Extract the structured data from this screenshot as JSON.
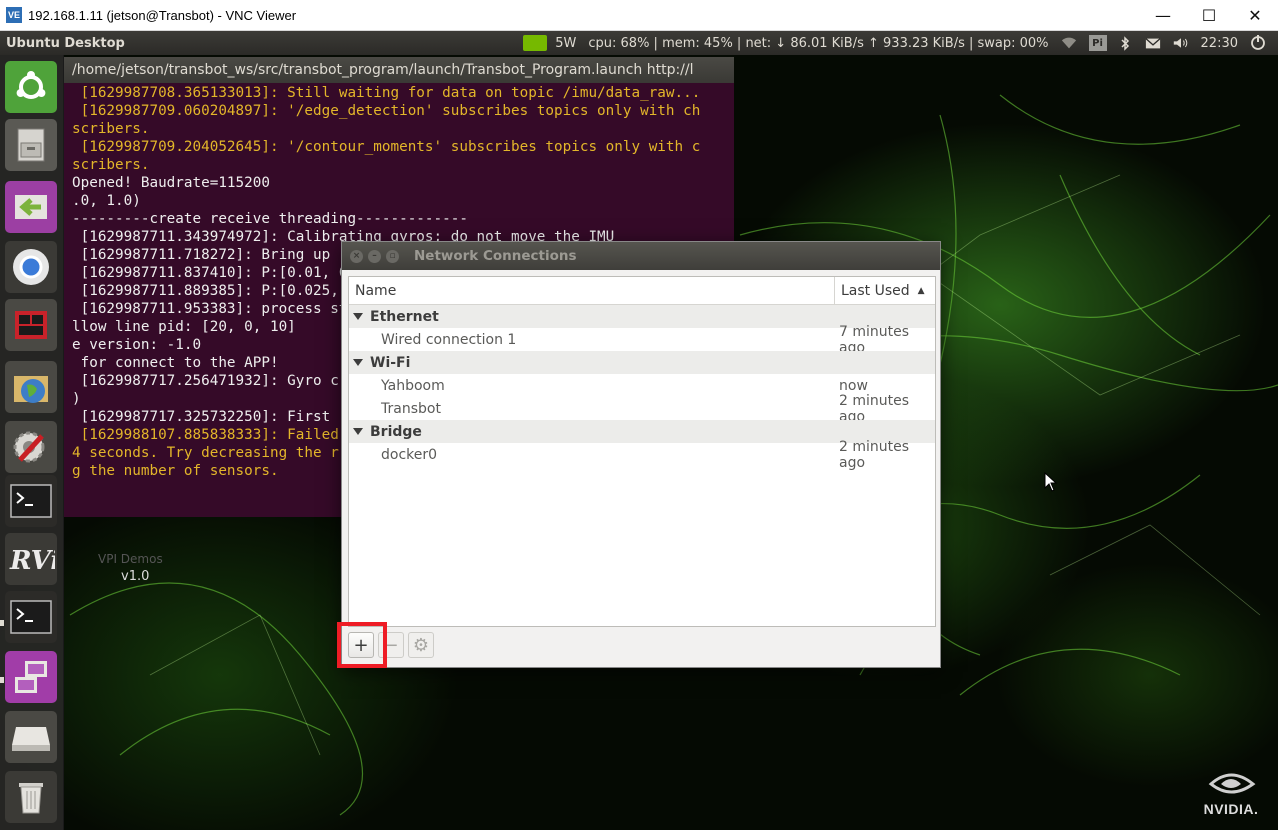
{
  "vnc_window": {
    "logo": "VE",
    "title": "192.168.1.11 (jetson@Transbot) - VNC Viewer",
    "minimize": "—",
    "maximize": "☐",
    "close": "✕"
  },
  "top_panel": {
    "title": "Ubuntu Desktop",
    "power": "5W",
    "stats": "cpu: 68% | mem: 45% | net: ↓ 86.01 KiB/s ↑ 933.23 KiB/s | swap: 00%",
    "pi_badge": "Pi",
    "clock": "22:30"
  },
  "terminal": {
    "title": "/home/jetson/transbot_ws/src/transbot_program/launch/Transbot_Program.launch http://l",
    "lines": [
      {
        "cls": "tl-w",
        "text": " [1629987708.365133013]: Still waiting for data on topic /imu/data_raw..."
      },
      {
        "cls": "tl-w",
        "text": " [1629987709.060204897]: '/edge_detection' subscribes topics only with ch"
      },
      {
        "cls": "tl-w",
        "text": "scribers."
      },
      {
        "cls": "tl-w",
        "text": " [1629987709.204052645]: '/contour_moments' subscribes topics only with c"
      },
      {
        "cls": "tl-w",
        "text": "scribers."
      },
      {
        "cls": "tl-n",
        "text": "Opened! Baudrate=115200"
      },
      {
        "cls": "tl-n",
        "text": ".0, 1.0)"
      },
      {
        "cls": "tl-n",
        "text": "---------create receive threading-------------"
      },
      {
        "cls": "tl-n",
        "text": " [1629987711.343974972]: Calibrating gyros; do not move the IMU"
      },
      {
        "cls": "tl-n",
        "text": " [1629987711.718272]: Bring up r"
      },
      {
        "cls": "tl-n",
        "text": " [1629987711.837410]: P:[0.01, 0"
      },
      {
        "cls": "tl-n",
        "text": " [1629987711.889385]: P:[0.025, "
      },
      {
        "cls": "tl-n",
        "text": " [1629987711.953383]: process st"
      },
      {
        "cls": "tl-n",
        "text": "llow line pid: [20, 0, 10]"
      },
      {
        "cls": "tl-n",
        "text": "e version: -1.0"
      },
      {
        "cls": "tl-n",
        "text": " for connect to the APP!"
      },
      {
        "cls": "tl-n",
        "text": " [1629987717.256471932]: Gyro c"
      },
      {
        "cls": "tl-n",
        "text": ")"
      },
      {
        "cls": "tl-n",
        "text": ""
      },
      {
        "cls": "tl-n",
        "text": " [1629987717.325732250]: First "
      },
      {
        "cls": "tl-w",
        "text": " [1629988107.885838333]: Failed"
      },
      {
        "cls": "tl-w",
        "text": "4 seconds. Try decreasing the r"
      },
      {
        "cls": "tl-w",
        "text": "g the number of sensors."
      }
    ]
  },
  "desktop": {
    "vpi_label": "VPI Demos",
    "vpi_version": "v1.0",
    "nvidia_text": "NVIDIA."
  },
  "network_dialog": {
    "title": "Network Connections",
    "col_name": "Name",
    "col_last_used": "Last Used",
    "groups": [
      {
        "name": "Ethernet",
        "items": [
          {
            "name": "Wired connection 1",
            "last": "7 minutes ago"
          }
        ]
      },
      {
        "name": "Wi-Fi",
        "items": [
          {
            "name": "Yahboom",
            "last": "now"
          },
          {
            "name": "Transbot",
            "last": "2 minutes ago"
          }
        ]
      },
      {
        "name": "Bridge",
        "items": [
          {
            "name": "docker0",
            "last": "2 minutes ago"
          }
        ]
      }
    ],
    "add": "+",
    "remove": "−",
    "settings": "⚙"
  },
  "colors": {
    "highlight": "#ee1c25",
    "nvidia_green": "#76b900",
    "terminal_warn": "#e3b62a"
  }
}
